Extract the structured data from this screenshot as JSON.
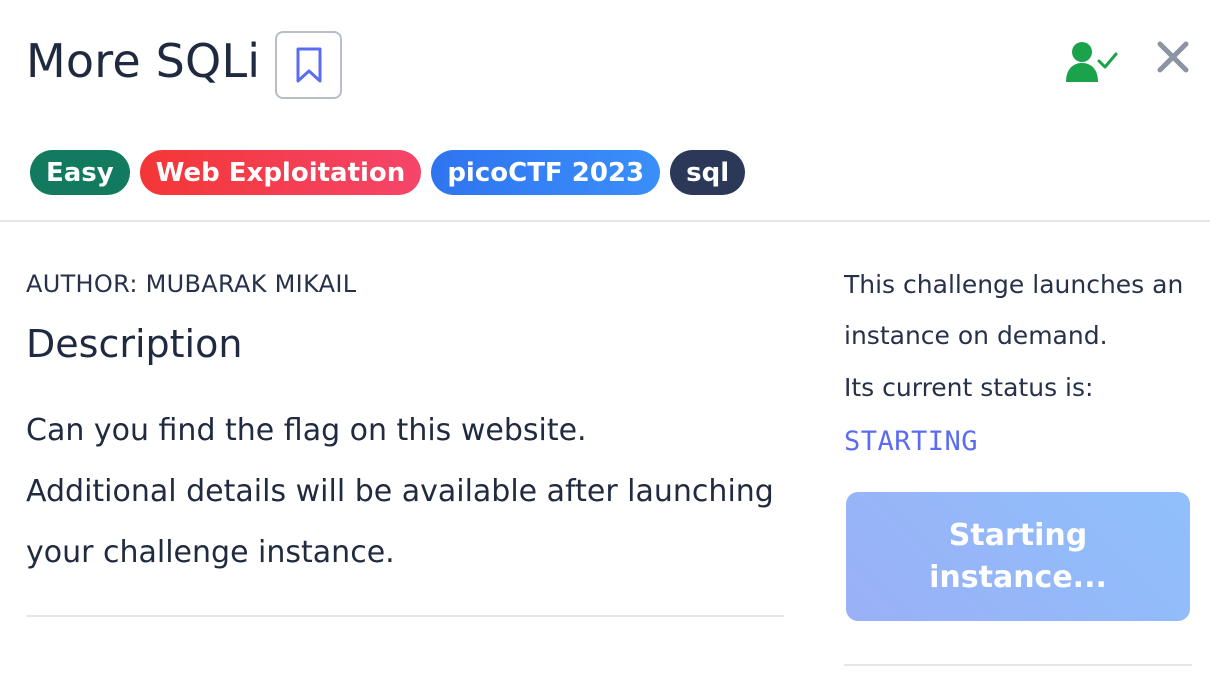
{
  "header": {
    "title": "More SQLi"
  },
  "tags": [
    {
      "label": "Easy",
      "color": "#117a5f"
    },
    {
      "label": "Web Exploitation",
      "color": "#f43f57"
    },
    {
      "label": "picoCTF 2023",
      "color": "#3182f6"
    },
    {
      "label": "sql",
      "color": "#2b3857"
    }
  ],
  "challenge": {
    "author": "AUTHOR: MUBARAK MIKAIL",
    "description_heading": "Description",
    "description_lines": [
      "Can you find the flag on this website.",
      "Additional details will be available after launching",
      "your challenge instance."
    ]
  },
  "instance": {
    "line1": "This challenge launches an",
    "line2": "instance on demand.",
    "line3": "Its current status is:",
    "status": "STARTING",
    "status_color": "#5b6cf0",
    "button_line1": "Starting",
    "button_line2": "instance..."
  },
  "icons": {
    "bookmark": "bookmark-icon",
    "solved": "user-check-icon",
    "close": "close-icon"
  },
  "colors": {
    "accent": "#5b6cf0",
    "solved_green": "#1aa34a"
  }
}
